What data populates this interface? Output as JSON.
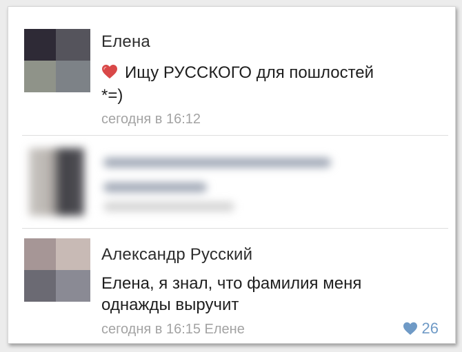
{
  "comments": [
    {
      "author": "Елена",
      "text": "Ищу РУССКОГО для пошлостей *=)",
      "text_line1": "Ищу РУССКОГО для пошлостей",
      "text_line2": "*=)",
      "meta": "сегодня в 16:12",
      "icon": "heart-emoji-icon",
      "avatar_colors": [
        "#2e2a36",
        "#55545c",
        "#8f9389",
        "#7d8287"
      ]
    },
    {
      "author": "",
      "text": "",
      "meta": "",
      "blurred": true,
      "avatar_colors": [
        "#b9b6b3",
        "#4a4a4e",
        "#d3d0cc",
        "#8e8b88"
      ]
    },
    {
      "author": "Александр Русский",
      "text": "Елена, я знал, что фамилия меня однажды выручит",
      "text_line1": "Елена, я знал, что фамилия меня",
      "text_line2": "однажды выручит",
      "meta": "сегодня в 16:15 Елене",
      "likes": "26",
      "like_icon": "heart-icon",
      "avatar_colors": [
        "#a69696",
        "#c8bab5",
        "#6b6a73",
        "#8a8a94"
      ]
    }
  ],
  "colors": {
    "background": "#ffffff",
    "meta_text": "#a3a3a3",
    "like_accent": "#6f9ac6",
    "divider": "#dedede"
  }
}
